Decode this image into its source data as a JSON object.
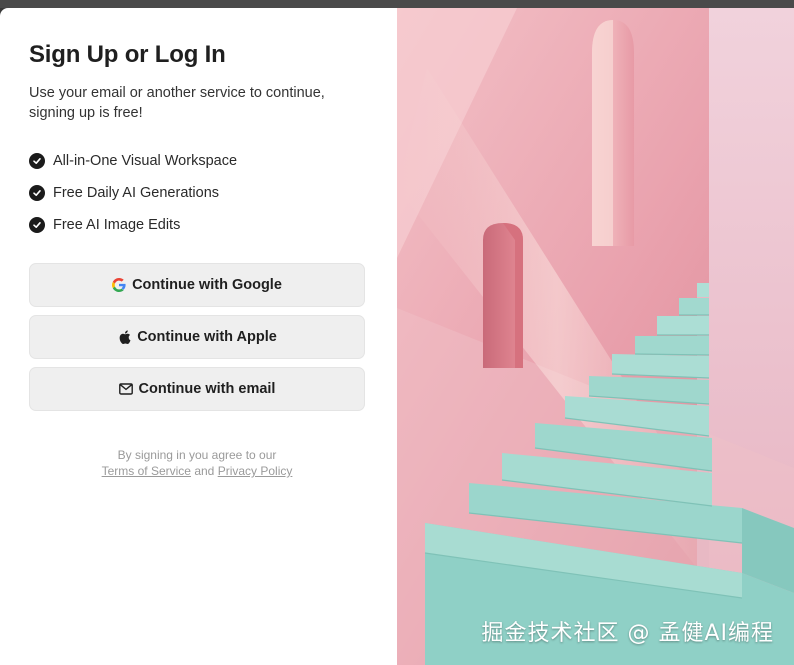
{
  "auth": {
    "title": "Sign Up or Log In",
    "subtitle": "Use your email or another service to continue, signing up is free!",
    "features": [
      "All-in-One Visual Workspace",
      "Free Daily AI Generations",
      "Free AI Image Edits"
    ],
    "buttons": {
      "google": "Continue with Google",
      "apple": "Continue with Apple",
      "email": "Continue with email"
    },
    "legal": {
      "prefix": "By signing in you agree to our",
      "terms": "Terms of Service",
      "and": "and",
      "privacy": "Privacy Policy"
    }
  },
  "image_panel": {
    "watermark": "掘金技术社区 @ 孟健AI编程"
  },
  "colors": {
    "wall_pink": "#e7a8b1",
    "stair_teal": "#9fd6cc",
    "button_bg": "#efefef"
  }
}
